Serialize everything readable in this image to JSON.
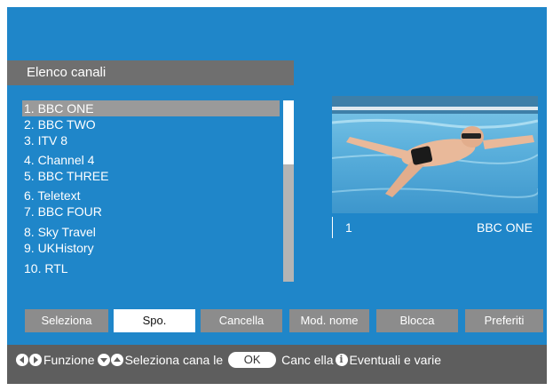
{
  "title": "Elenco canali",
  "channels": [
    {
      "label": "1. BBC ONE",
      "selected": true
    },
    {
      "label": "2. BBC TWO"
    },
    {
      "label": "3. ITV 8"
    },
    {
      "label": "4. Channel 4"
    },
    {
      "label": "5. BBC THREE"
    },
    {
      "label": "6. Teletext"
    },
    {
      "label": "7. BBC FOUR"
    },
    {
      "label": "8. Sky Travel"
    },
    {
      "label": "9. UKHistory"
    },
    {
      "label": "10. RTL"
    }
  ],
  "preview": {
    "number": "1",
    "name": "BBC ONE"
  },
  "buttons": {
    "seleziona": "Seleziona",
    "spo": "Spo.",
    "cancella": "Cancella",
    "mod_nome": "Mod. nome",
    "blocca": "Blocca",
    "preferiti": "Preferiti"
  },
  "help": {
    "funzione": "Funzione",
    "seleziona_canale": "Seleziona cana le",
    "ok": "OK",
    "cancella": "Canc ella",
    "info": "i",
    "eventuali": "Eventuali e varie"
  },
  "colors": {
    "background": "#1f86c9",
    "title_bar": "#6f6f6f",
    "selection": "#9a9a9a",
    "button": "#8c8c8c",
    "help_bar": "#5e5e5e"
  }
}
